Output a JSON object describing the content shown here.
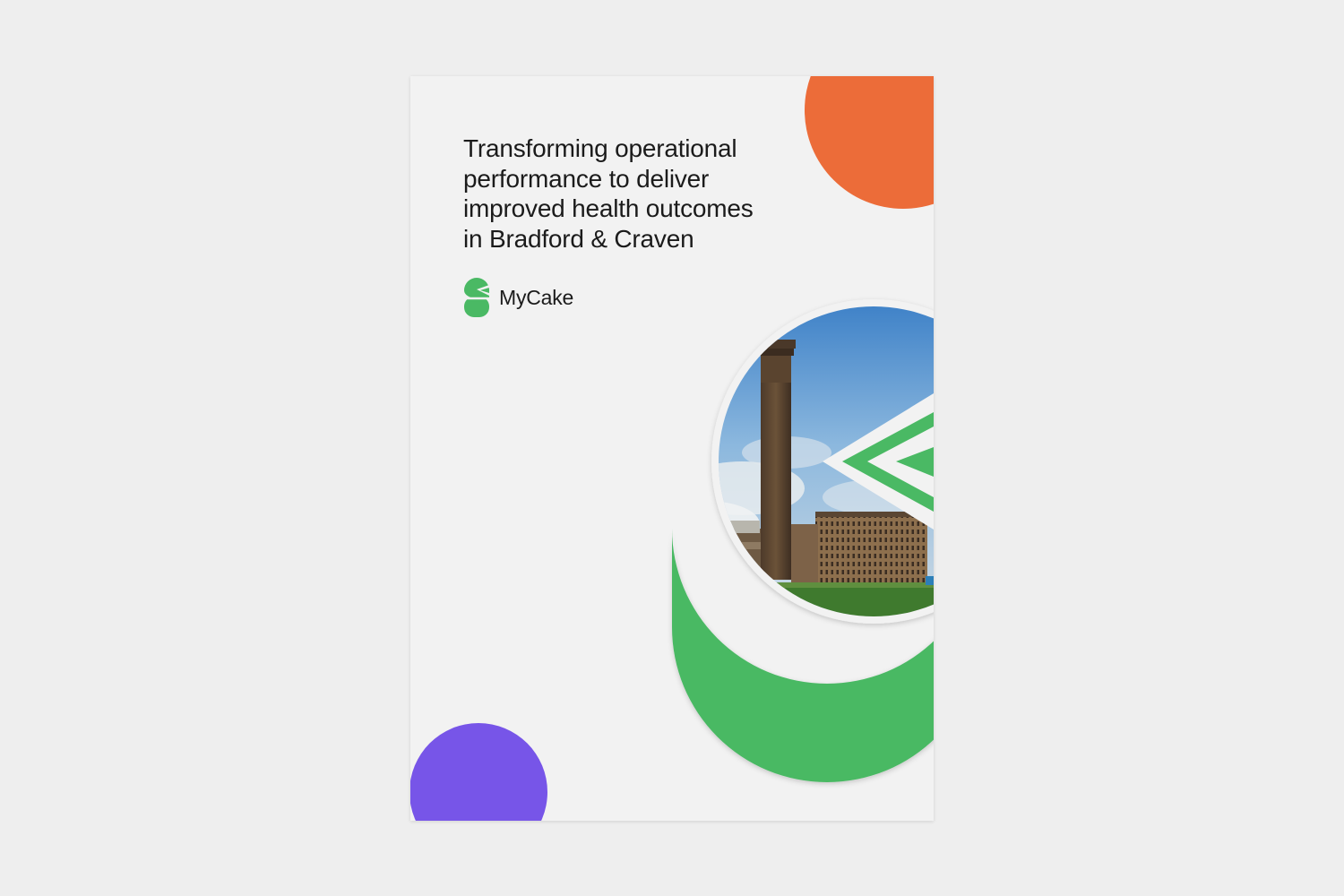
{
  "document": {
    "title_lines": [
      "Transforming operational",
      "performance to deliver",
      "improved health outcomes",
      "in Bradford & Craven"
    ],
    "brand": {
      "name": "MyCake",
      "icon": "mycake-logo-icon"
    },
    "photo": {
      "icon": "mill-chimney-photo"
    }
  },
  "colors": {
    "page_background": "#eeeeee",
    "cover_background": "#f2f2f2",
    "orange": "#ec6c39",
    "green": "#4ab964",
    "purple": "#7755e8",
    "text": "#1b1b1b"
  }
}
